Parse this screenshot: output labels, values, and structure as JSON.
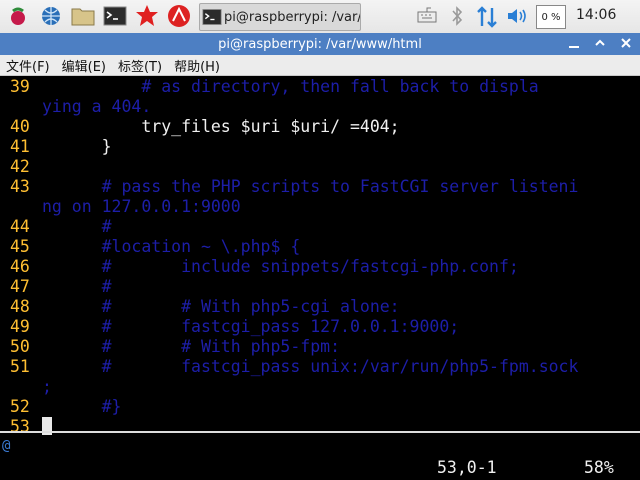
{
  "taskbar": {
    "task_label": "pi@raspberrypi: /var/...",
    "cpu_label": "0 %",
    "clock": "14:06",
    "icons": [
      "raspberry-icon",
      "web-browser-icon",
      "file-manager-icon",
      "terminal-icon",
      "wolfram-icon",
      "mathematica-icon"
    ]
  },
  "window": {
    "title": "pi@raspberrypi: /var/www/html"
  },
  "menu": {
    "file": "文件(F)",
    "edit": "编辑(E)",
    "tabs": "标签(T)",
    "help": "帮助(H)"
  },
  "terminal": {
    "lines": [
      {
        "n": "39",
        "t": "          # as directory, then fall back to displa",
        "c": "comment"
      },
      {
        "n": "",
        "t": "ying a 404.",
        "c": "comment"
      },
      {
        "n": "40",
        "t": "          try_files $uri $uri/ =404;",
        "c": "code"
      },
      {
        "n": "41",
        "t": "      }",
        "c": "code"
      },
      {
        "n": "42",
        "t": "",
        "c": "code"
      },
      {
        "n": "43",
        "t": "      # pass the PHP scripts to FastCGI server listeni",
        "c": "comment"
      },
      {
        "n": "",
        "t": "ng on 127.0.0.1:9000",
        "c": "comment"
      },
      {
        "n": "44",
        "t": "      #",
        "c": "comment"
      },
      {
        "n": "45",
        "t": "      #location ~ \\.php$ {",
        "c": "comment"
      },
      {
        "n": "46",
        "t": "      #       include snippets/fastcgi-php.conf;",
        "c": "comment"
      },
      {
        "n": "47",
        "t": "      #",
        "c": "comment"
      },
      {
        "n": "48",
        "t": "      #       # With php5-cgi alone:",
        "c": "comment"
      },
      {
        "n": "49",
        "t": "      #       fastcgi_pass 127.0.0.1:9000;",
        "c": "comment"
      },
      {
        "n": "50",
        "t": "      #       # With php5-fpm:",
        "c": "comment"
      },
      {
        "n": "51",
        "t": "      #       fastcgi_pass unix:/var/run/php5-fpm.sock",
        "c": "comment"
      },
      {
        "n": "",
        "t": ";",
        "c": "comment"
      },
      {
        "n": "52",
        "t": "      #}",
        "c": "comment"
      },
      {
        "n": "53",
        "t": "",
        "c": "code"
      }
    ],
    "mode_indicator": "@",
    "position": "53,0-1",
    "percent": "58%"
  },
  "colors": {
    "line_number": "#ffbf32",
    "comment": "#1d1ea8",
    "titlebar": "#4d7fc3"
  }
}
